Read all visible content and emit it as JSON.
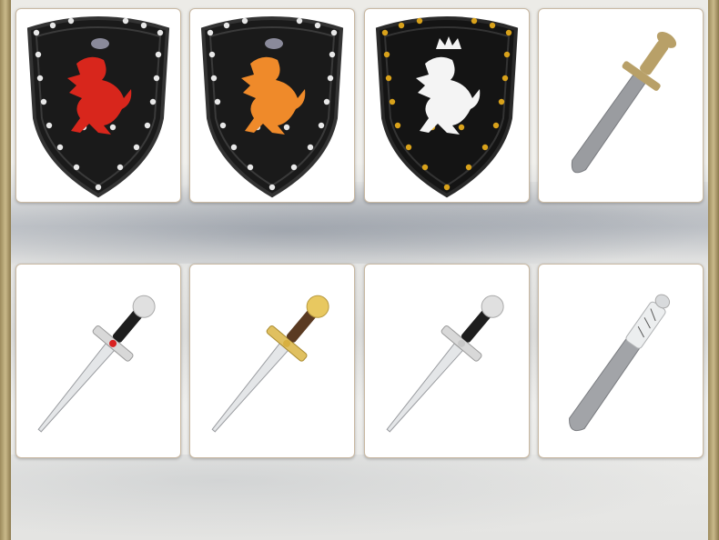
{
  "products": [
    {
      "kind": "shield",
      "emblem": "lion-rampant",
      "emblem_color": "#d8261c",
      "stud_color": "#e8e8e8",
      "crest": "helmet"
    },
    {
      "kind": "shield",
      "emblem": "lion-rampant",
      "emblem_color": "#ef8a2a",
      "stud_color": "#e8e8e8",
      "crest": "helmet"
    },
    {
      "kind": "shield",
      "emblem": "crowned-lion-rampant",
      "emblem_color": "#f4f4f4",
      "stud_color": "#d9a21b",
      "crest": "crown"
    },
    {
      "kind": "sword",
      "style": "gladius",
      "blade_color": "#9a9ca0",
      "hilt_color": "#b8a068"
    },
    {
      "kind": "dagger",
      "grip_color": "#1e1e1e",
      "guard_color": "#d8d8d8",
      "pommel_color": "#e0e0e0",
      "gem_color": "#d82020"
    },
    {
      "kind": "dagger",
      "grip_color": "#5a3a22",
      "guard_color": "#e0c060",
      "pommel_color": "#e8c860",
      "gem_color": "#d8b040"
    },
    {
      "kind": "dagger",
      "grip_color": "#1e1e1e",
      "guard_color": "#d8d8d8",
      "pommel_color": "#e0e0e0",
      "gem_color": "#c8c8c8"
    },
    {
      "kind": "sword",
      "style": "sheathed-short",
      "blade_color": "#a2a4a8",
      "hilt_color": "#d8dadc"
    }
  ],
  "colors": {
    "shield_body": "#1a1a1a",
    "shield_rim": "#2e2e2e",
    "card_border": "#c9b9a3",
    "frame": "#b8a878"
  }
}
